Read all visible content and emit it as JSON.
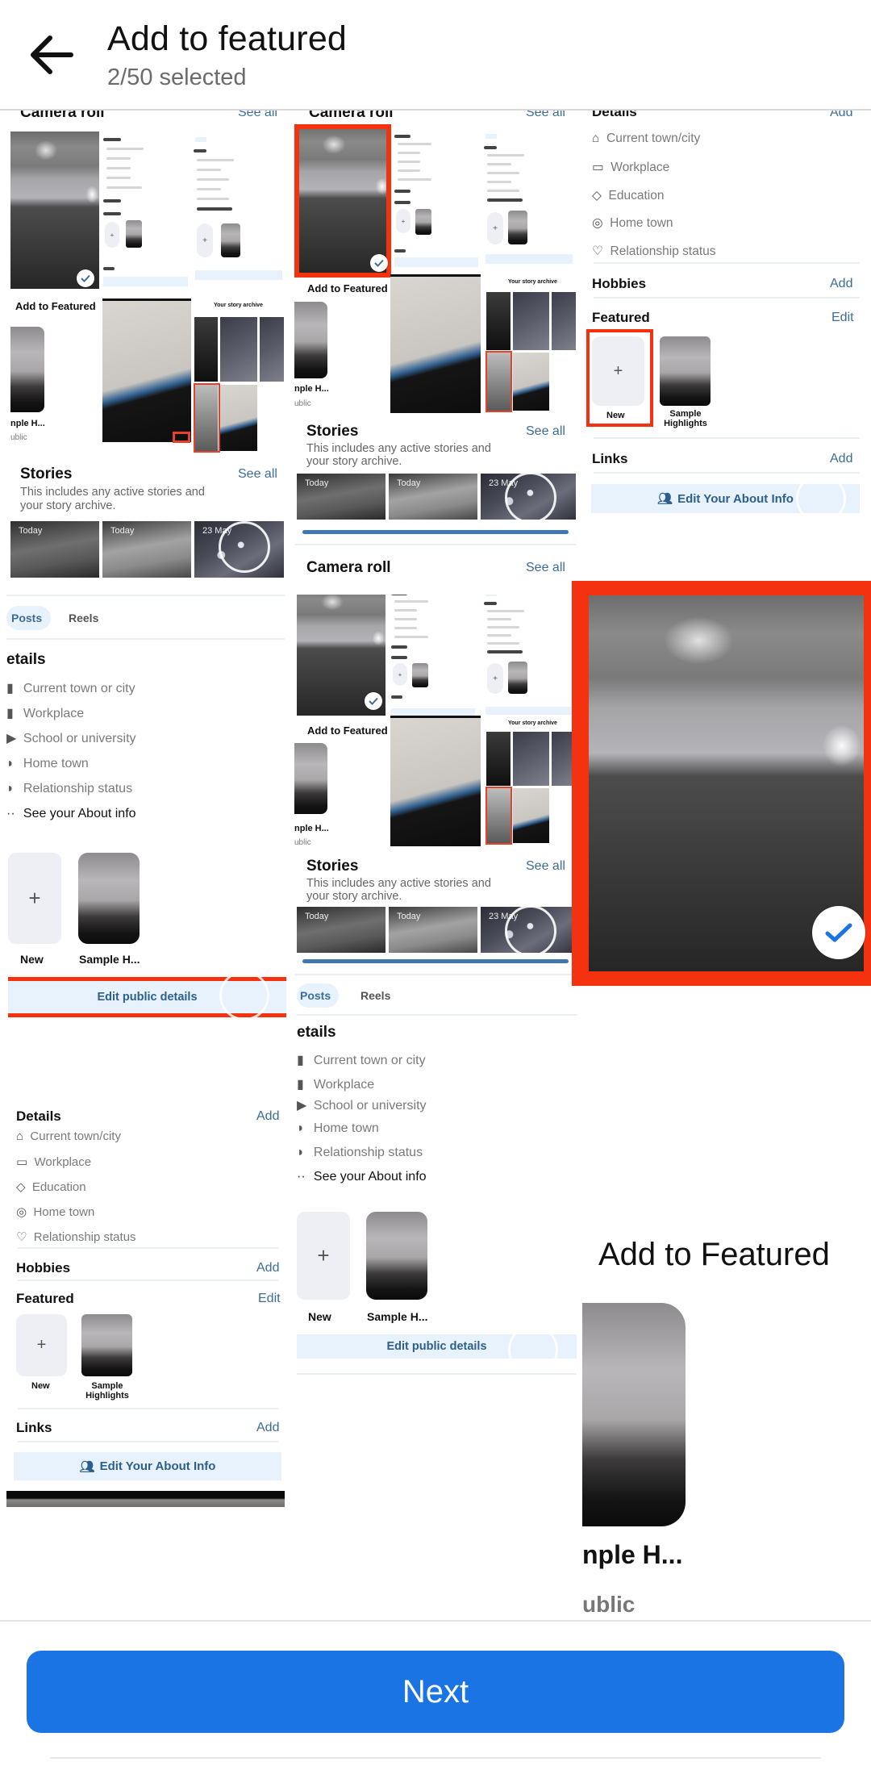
{
  "header": {
    "back_icon": "arrow-left-icon",
    "title": "Add to featured",
    "selection_count": "2/50 selected"
  },
  "colors": {
    "accent_blue": "#1b74e4",
    "link_blue": "#3c6e99",
    "selection_red": "#f4320f",
    "soft_button_bg": "#e7f2fc"
  },
  "camera_roll": {
    "title": "Camera roll",
    "see_all": "See all",
    "add_to_featured": "Add to Featured",
    "highlight_name_clipped": "nple H...",
    "privacy_clipped": "ublic",
    "story_archive_label": "Your story archive"
  },
  "stories": {
    "title": "Stories",
    "see_all": "See all",
    "description": "This includes any active stories and your story archive.",
    "thumbnails": [
      {
        "label": "Today"
      },
      {
        "label": "Today"
      },
      {
        "label": "23 May"
      }
    ]
  },
  "posts_panel": {
    "tabs": [
      {
        "label": "Posts",
        "active": true
      },
      {
        "label": "Reels",
        "active": false
      }
    ],
    "details_heading_clipped": "etails",
    "items": [
      {
        "icon": "city-icon",
        "label": "Current town or city"
      },
      {
        "icon": "briefcase-icon",
        "label": "Workplace"
      },
      {
        "icon": "school-icon",
        "label": "School or university"
      },
      {
        "icon": "home-town-icon",
        "label": "Home town"
      },
      {
        "icon": "heart-icon",
        "label": "Relationship status"
      },
      {
        "icon": "more-icon",
        "label": "See your About info"
      }
    ],
    "new_label": "New",
    "highlight_label": "Sample H...",
    "edit_button": "Edit public details"
  },
  "about_panel": {
    "details_title": "Details",
    "details_action": "Add",
    "items": [
      {
        "icon": "house-icon",
        "label": "Current town/city"
      },
      {
        "icon": "briefcase-icon",
        "label": "Workplace"
      },
      {
        "icon": "graduation-cap-icon",
        "label": "Education"
      },
      {
        "icon": "location-pin-icon",
        "label": "Home town"
      },
      {
        "icon": "relationship-icon",
        "label": "Relationship status"
      }
    ],
    "hobbies_title": "Hobbies",
    "hobbies_action": "Add",
    "featured_title": "Featured",
    "featured_action": "Edit",
    "new_label": "New",
    "highlight_label": "Sample Highlights",
    "links_title": "Links",
    "links_action": "Add",
    "edit_about_button": "Edit Your About Info"
  },
  "selected_photo": {
    "selected": true,
    "check_icon": "checkmark-icon"
  },
  "footer": {
    "next_button": "Next"
  }
}
